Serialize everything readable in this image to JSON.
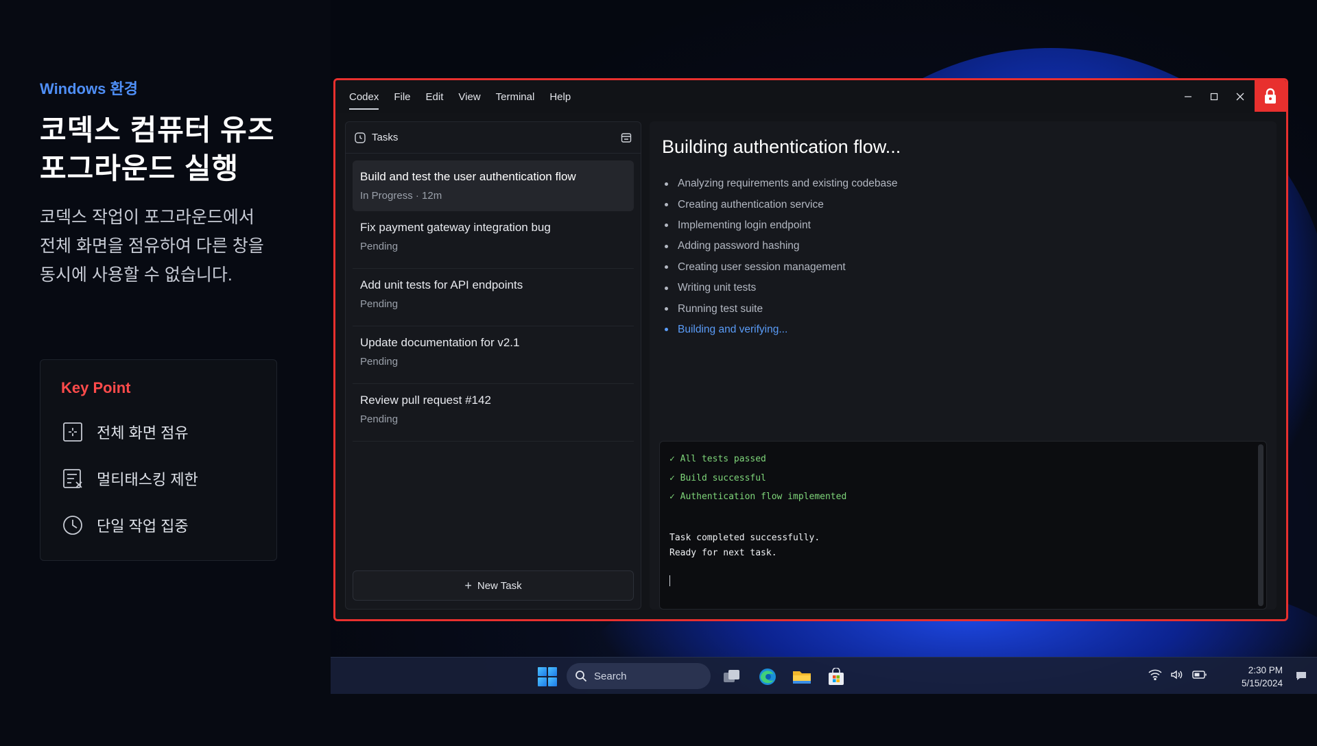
{
  "left": {
    "env_label": "Windows 환경",
    "title_line1": "코덱스 컴퓨터 유즈",
    "title_line2": "포그라운드 실행",
    "desc_line1": "코덱스 작업이 포그라운드에서",
    "desc_line2": "전체 화면을 점유하여 다른 창을",
    "desc_line3": "동시에 사용할 수 없습니다.",
    "keypoint": {
      "title": "Key Point",
      "items": [
        "전체 화면 점유",
        "멀티태스킹 제한",
        "단일 작업 집중"
      ]
    }
  },
  "window": {
    "menu": [
      "Codex",
      "File",
      "Edit",
      "View",
      "Terminal",
      "Help"
    ],
    "tasks_header": "Tasks",
    "tasks": [
      {
        "title": "Build and test the user authentication flow",
        "status": "In Progress · 12m"
      },
      {
        "title": "Fix payment gateway integration bug",
        "status": "Pending"
      },
      {
        "title": "Add unit tests for API endpoints",
        "status": "Pending"
      },
      {
        "title": "Update documentation for v2.1",
        "status": "Pending"
      },
      {
        "title": "Review pull request #142",
        "status": "Pending"
      }
    ],
    "new_task_label": "New Task",
    "content_title": "Building authentication flow...",
    "steps": [
      "Analyzing requirements and existing codebase",
      "Creating authentication service",
      "Implementing login endpoint",
      "Adding password hashing",
      "Creating user session management",
      "Writing unit tests",
      "Running test suite",
      "Building and verifying..."
    ],
    "terminal": {
      "ok_lines": [
        "✓ All tests passed",
        "✓ Build successful",
        "✓ Authentication flow implemented"
      ],
      "line1": "Task completed successfully.",
      "line2": "Ready for next task."
    }
  },
  "taskbar": {
    "search_label": "Search",
    "time": "2:30 PM",
    "date": "5/15/2024"
  },
  "colors": {
    "accent_red": "#e8302e",
    "accent_blue": "#4f8ff7",
    "success_green": "#7fd67a"
  }
}
